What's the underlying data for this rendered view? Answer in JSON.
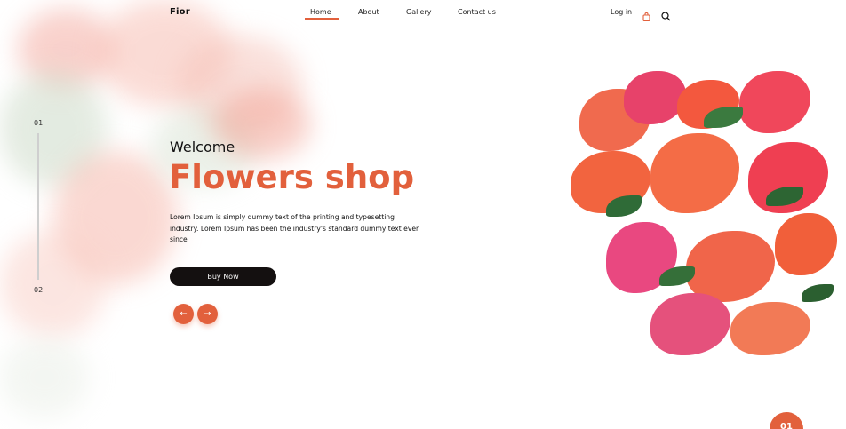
{
  "header": {
    "logo": "Fior",
    "menu": [
      "Home",
      "About",
      "Gallery",
      "Contact us"
    ],
    "active_menu": "Home",
    "login": "Log in",
    "icons": [
      "shopping-bag-icon",
      "search-icon"
    ]
  },
  "slider": {
    "numbers": [
      "01",
      "02"
    ]
  },
  "hero": {
    "welcome": "Welcome",
    "title": "Flowers shop",
    "description": "Lorem Ipsum is simply dummy text of the printing and typesetting industry. Lorem Ipsum has been the industry's standard dummy text ever since",
    "button_label": "Buy Now",
    "prev_arrow": "←",
    "next_arrow": "→"
  },
  "badge": {
    "label": "01"
  },
  "colors": {
    "accent": "#e2603c",
    "button": "#141010",
    "text": "#111111"
  }
}
